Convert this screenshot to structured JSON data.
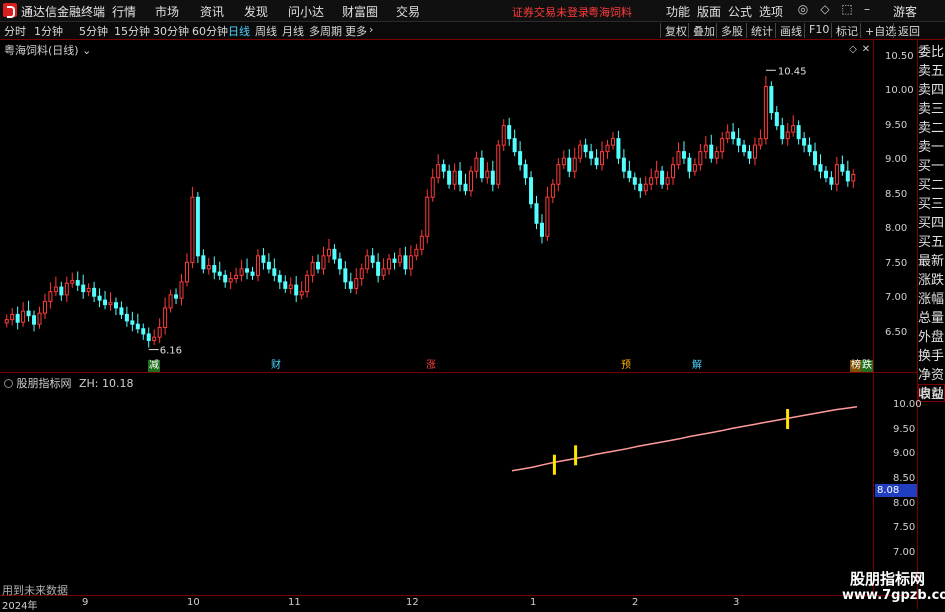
{
  "app": {
    "title": "通达信金融终端",
    "menus": [
      "行情",
      "市场",
      "资讯",
      "发现",
      "问小达",
      "财富圈",
      "交易"
    ],
    "notice": [
      "证券交易未登录",
      "粤海饲料"
    ],
    "right_menus": [
      "功能",
      "版面",
      "公式",
      "选项"
    ],
    "guest": "游客"
  },
  "periods": [
    "分时",
    "1分钟",
    "5分钟",
    "15分钟",
    "30分钟",
    "60分钟",
    "日线",
    "周线",
    "月线",
    "多周期",
    "更多"
  ],
  "active_period": "日线",
  "toolbar": [
    "复权",
    "叠加",
    "多股",
    "统计",
    "画线",
    "F10",
    "标记",
    "+自选",
    "返回"
  ],
  "main_chart": {
    "title": "粤海饲料(日线)",
    "y_ticks": [
      "10.50",
      "10.00",
      "9.50",
      "9.00",
      "8.50",
      "8.00",
      "7.50",
      "7.00",
      "6.50"
    ],
    "max_label": "10.45",
    "min_label": "6.16",
    "events": [
      {
        "text": "减",
        "color": "#3cc43c"
      },
      {
        "text": "财",
        "color": "#4fd3ff"
      },
      {
        "text": "涨",
        "color": "#ff4040"
      },
      {
        "text": "预",
        "color": "#ffb000"
      },
      {
        "text": "解",
        "color": "#4fd3ff"
      },
      {
        "text": "榜",
        "color": "#ffb000"
      },
      {
        "text": "跌",
        "color": "#3cc43c"
      }
    ]
  },
  "side_panel": [
    "委比",
    "卖五",
    "卖四",
    "卖三",
    "卖二",
    "卖一",
    "买一",
    "买二",
    "买三",
    "买四",
    "买五",
    "最新",
    "涨跌",
    "涨幅",
    "总量",
    "外盘",
    "换手",
    "净资",
    "收益"
  ],
  "auto_label": "自动",
  "sub_chart": {
    "title": "股朋指标网",
    "value_label": "ZH: 10.18",
    "y_ticks": [
      "10.00",
      "9.50",
      "9.00",
      "8.50",
      "8.00",
      "7.50",
      "7.00"
    ],
    "current_value": "8.08"
  },
  "x_axis": [
    "2024年",
    "9",
    "10",
    "11",
    "12",
    "1",
    "2",
    "3"
  ],
  "footnote": "用到未来数据",
  "watermark": {
    "line1": "股朋指标网",
    "line2": "www.7gpzb.com"
  },
  "chart_data": [
    {
      "type": "candlestick",
      "title": "粤海饲料(日线)",
      "ylim": [
        6.0,
        10.7
      ],
      "closes": [
        6.62,
        6.7,
        6.58,
        6.75,
        6.68,
        6.55,
        6.72,
        6.9,
        7.05,
        7.12,
        7.0,
        7.18,
        7.22,
        7.15,
        7.05,
        7.1,
        6.98,
        6.92,
        6.85,
        6.88,
        6.8,
        6.7,
        6.6,
        6.55,
        6.48,
        6.4,
        6.3,
        6.35,
        6.5,
        6.8,
        7.0,
        6.95,
        7.2,
        7.5,
        8.5,
        7.6,
        7.4,
        7.45,
        7.35,
        7.3,
        7.2,
        7.25,
        7.3,
        7.4,
        7.35,
        7.3,
        7.6,
        7.5,
        7.4,
        7.3,
        7.2,
        7.1,
        7.15,
        7.0,
        7.05,
        7.3,
        7.5,
        7.4,
        7.6,
        7.7,
        7.55,
        7.4,
        7.2,
        7.1,
        7.25,
        7.4,
        7.6,
        7.5,
        7.3,
        7.4,
        7.55,
        7.5,
        7.6,
        7.4,
        7.6,
        7.7,
        7.9,
        8.5,
        8.8,
        9.0,
        8.9,
        8.7,
        8.9,
        8.7,
        8.6,
        8.9,
        9.1,
        8.8,
        8.9,
        8.7,
        9.3,
        9.6,
        9.4,
        9.2,
        9.0,
        8.8,
        8.4,
        8.1,
        7.9,
        8.5,
        8.7,
        9.0,
        9.1,
        8.9,
        9.1,
        9.3,
        9.2,
        9.1,
        9.0,
        9.2,
        9.3,
        9.4,
        9.1,
        8.9,
        8.8,
        8.7,
        8.6,
        8.7,
        8.8,
        8.9,
        8.7,
        8.8,
        9.0,
        9.2,
        9.1,
        8.9,
        9.0,
        9.2,
        9.3,
        9.1,
        9.2,
        9.4,
        9.5,
        9.4,
        9.3,
        9.2,
        9.1,
        9.3,
        9.4,
        10.2,
        9.8,
        9.6,
        9.4,
        9.5,
        9.6,
        9.4,
        9.3,
        9.2,
        9.0,
        8.9,
        8.8,
        8.7,
        9.0,
        8.9,
        8.75,
        8.85
      ],
      "max": 10.45,
      "min": 6.16
    },
    {
      "type": "line",
      "title": "股朋指标网",
      "series": [
        {
          "name": "ZH",
          "values": [
            8.82,
            8.86,
            8.9,
            8.95,
            9.0,
            9.04,
            9.08,
            9.12,
            9.17,
            9.21,
            9.25,
            9.29,
            9.34,
            9.38,
            9.42,
            9.46,
            9.5,
            9.55,
            9.59,
            9.63,
            9.67,
            9.72,
            9.76,
            9.8,
            9.84,
            9.88,
            9.92,
            9.96,
            10.0,
            10.04,
            10.08,
            10.12,
            10.15,
            10.18
          ]
        }
      ],
      "ylim": [
        6.8,
        10.6
      ],
      "markers": [
        {
          "index": 8,
          "value": 8.95
        },
        {
          "index": 12,
          "value": 9.15
        },
        {
          "index": 52,
          "value": 9.92
        }
      ]
    }
  ]
}
